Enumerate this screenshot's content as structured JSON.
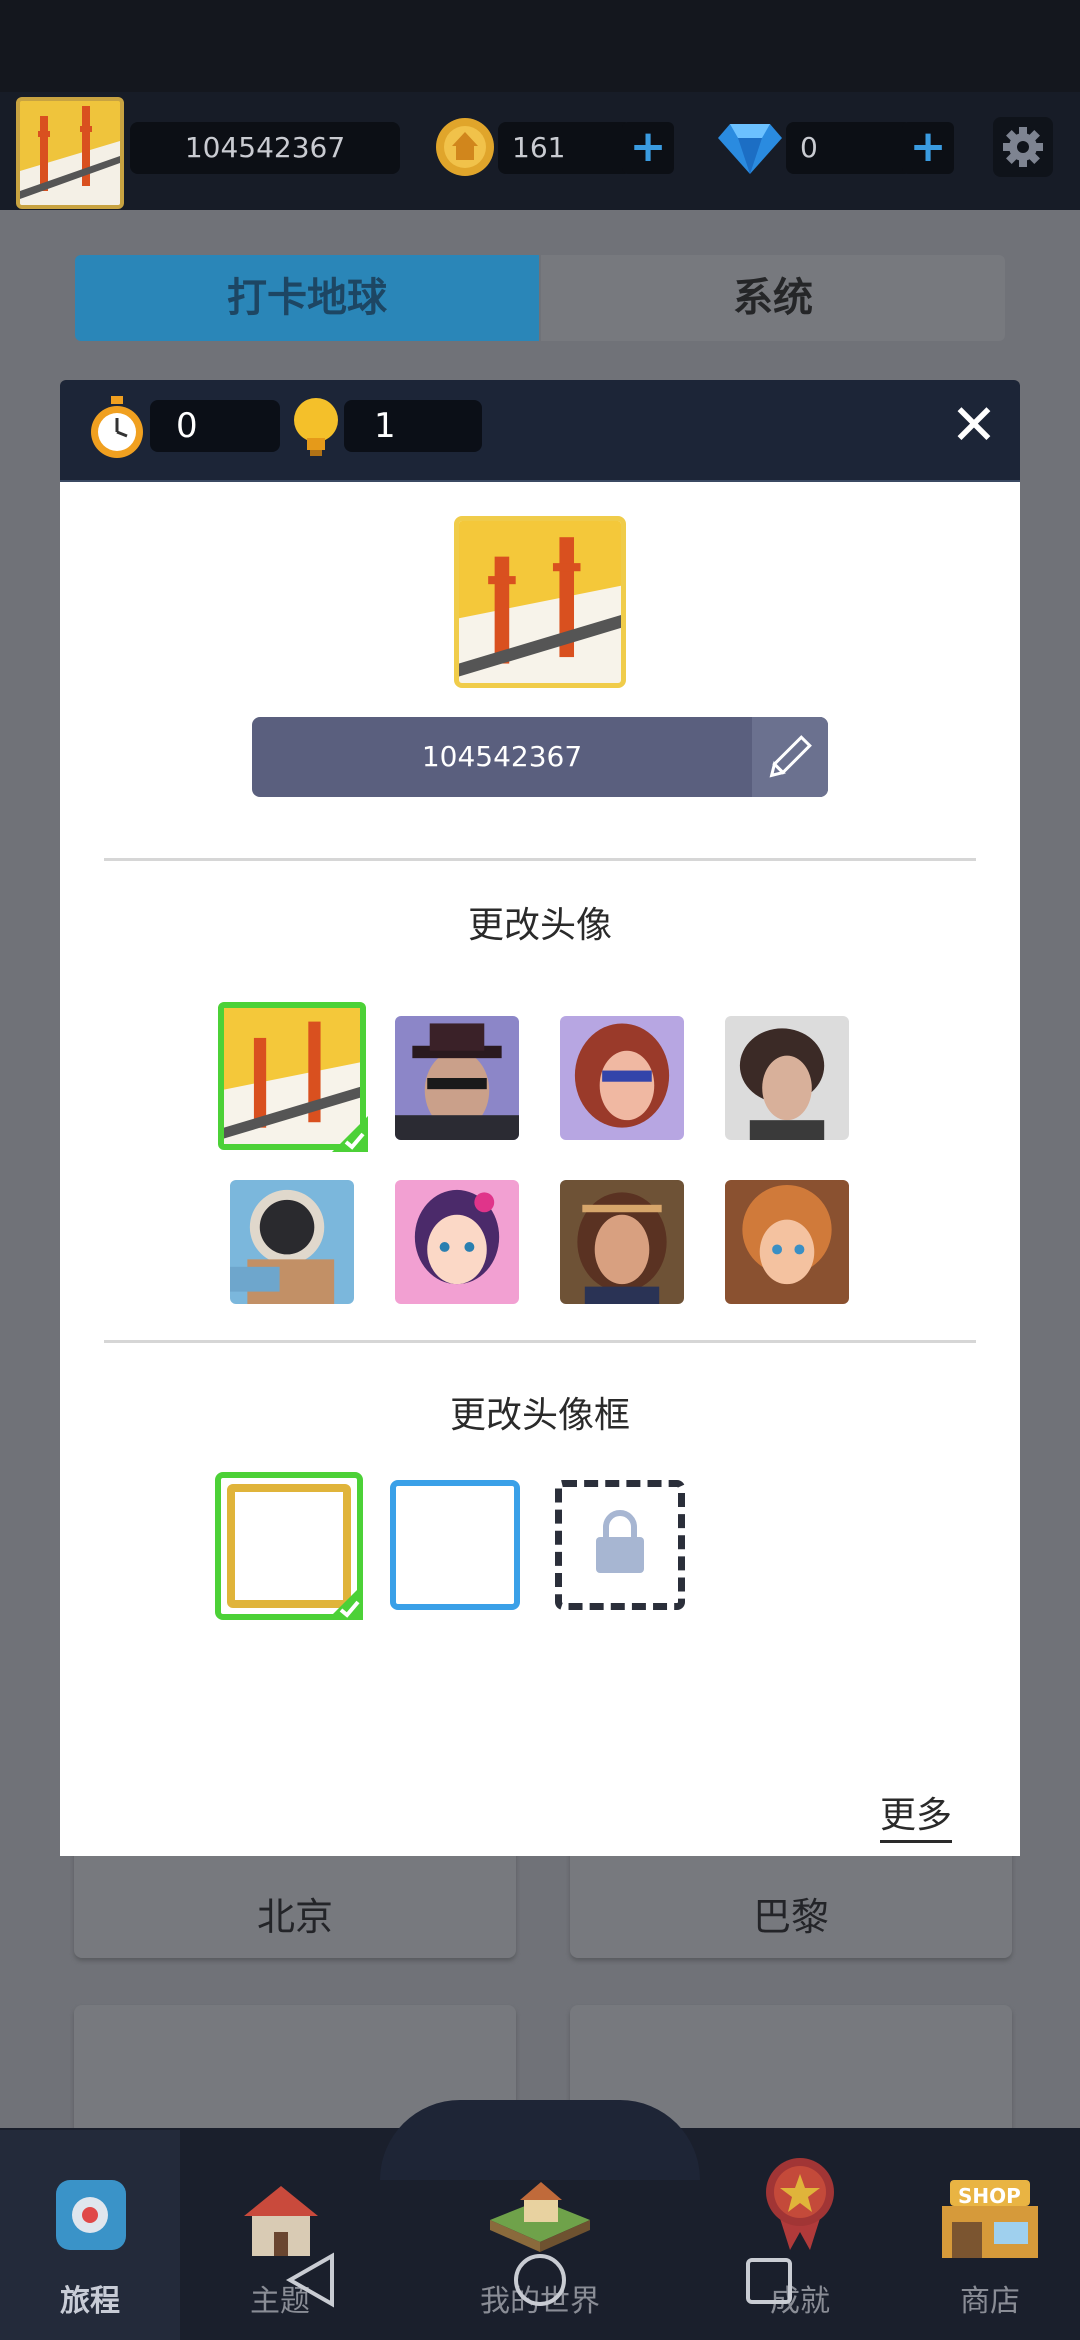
{
  "topbar": {
    "player_id": "104542367",
    "coins": "161",
    "diamonds": "0"
  },
  "tabs": [
    {
      "label": "打卡地球",
      "active": true
    },
    {
      "label": "系统",
      "active": false
    }
  ],
  "background_cards": [
    "北京",
    "巴黎"
  ],
  "dialog": {
    "timer_count": "0",
    "hint_count": "1",
    "player_name": "104542367",
    "avatar_section_title": "更改头像",
    "frame_section_title": "更改头像框",
    "more_label": "更多",
    "avatars": [
      {
        "name": "golden-gate-bridge",
        "selected": true
      },
      {
        "name": "masked-man-hat",
        "selected": false
      },
      {
        "name": "masked-woman",
        "selected": false
      },
      {
        "name": "beethoven",
        "selected": false
      },
      {
        "name": "astronaut",
        "selected": false
      },
      {
        "name": "purple-hair-girl",
        "selected": false
      },
      {
        "name": "headband-girl",
        "selected": false
      },
      {
        "name": "curly-hair-kid",
        "selected": false
      }
    ],
    "frames": [
      {
        "name": "gold-frame",
        "selected": true,
        "locked": false
      },
      {
        "name": "blue-frame",
        "selected": false,
        "locked": false
      },
      {
        "name": "locked-frame",
        "selected": false,
        "locked": true
      }
    ]
  },
  "bottom_nav": [
    {
      "label": "旅程",
      "active": true
    },
    {
      "label": "主题",
      "active": false
    },
    {
      "label": "我的世界",
      "active": false
    },
    {
      "label": "成就",
      "active": false
    },
    {
      "label": "商店",
      "active": false
    }
  ],
  "shop_badge": "SHOP",
  "colors": {
    "accent_blue": "#2a9ad8",
    "selected_green": "#4cd137",
    "gold": "#e0b43a",
    "dialog_header": "#1c2537"
  }
}
